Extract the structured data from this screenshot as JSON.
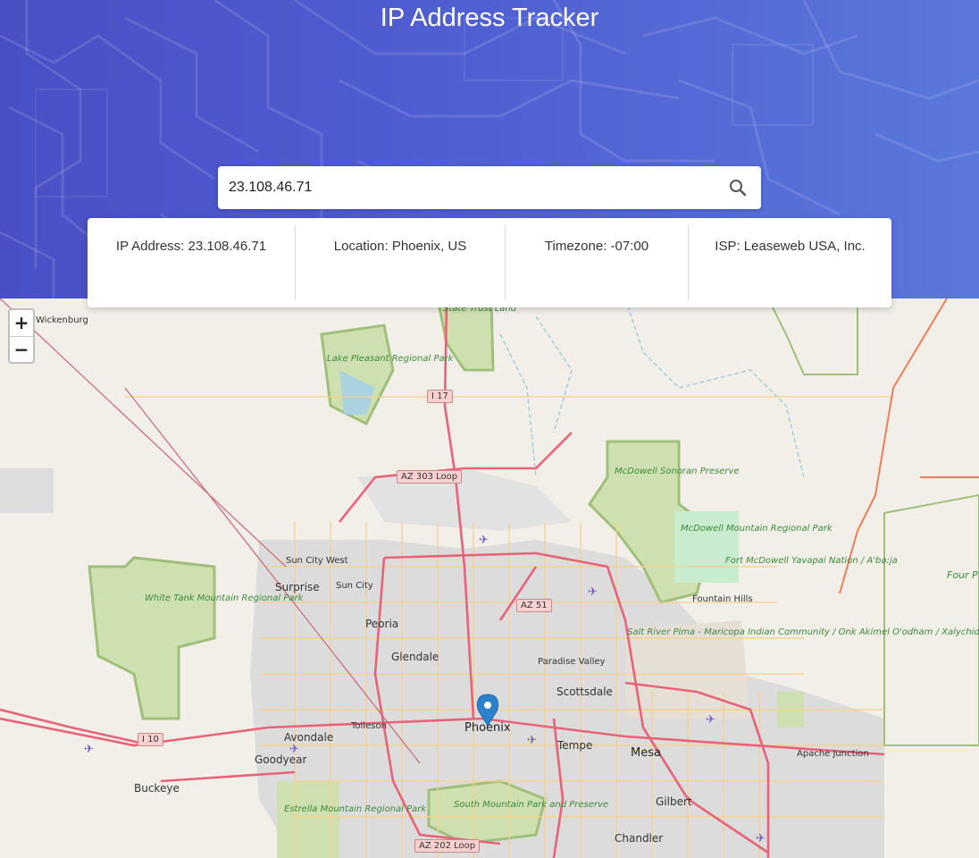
{
  "header": {
    "title": "IP Address Tracker"
  },
  "search": {
    "value": "23.108.46.71",
    "icon": "search-icon"
  },
  "info": {
    "ip": "IP Address: 23.108.46.71",
    "location": "Location: Phoenix, US",
    "timezone": "Timezone: -07:00",
    "isp": "ISP: Leaseweb USA, Inc."
  },
  "zoom": {
    "in": "+",
    "out": "−"
  },
  "map": {
    "places": {
      "wickenburg": "Wickenburg",
      "sun_city_west": "Sun City West",
      "surprise": "Surprise",
      "sun_city": "Sun City",
      "peoria": "Peoria",
      "glendale": "Glendale",
      "paradise_valley": "Paradise Valley",
      "scottsdale": "Scottsdale",
      "fountain_hills": "Fountain Hills",
      "tolleson": "Tolleson",
      "avondale": "Avondale",
      "goodyear": "Goodyear",
      "buckeye": "Buckeye",
      "phoenix": "Phoenix",
      "tempe": "Tempe",
      "mesa": "Mesa",
      "apache_junction": "Apache Junction",
      "gilbert": "Gilbert",
      "chandler": "Chandler"
    },
    "parks": {
      "state_trust": "State Trust Land",
      "lake_pleasant": "Lake Pleasant Regional Park",
      "mcdowell_sonoran": "McDowell Sonoran Preserve",
      "mcdowell_mountain": "McDowell Mountain Regional Park",
      "fort_mcdowell": "Fort McDowell Yavapai Nation / A'ba:ja",
      "four_peaks": "Four P Wilder",
      "white_tank": "White Tank Mountain Regional Park",
      "salt_river": "Salt River Pima - Maricopa Indian Community / Onk Akimel O'odham / Xalychidom Piipaash",
      "south_mountain": "South Mountain Park and Preserve",
      "estrella": "Estrella Mountain Regional Park"
    },
    "shields": {
      "i17": "I 17",
      "az303": "AZ 303 Loop",
      "az51": "AZ 51",
      "i10": "I 10",
      "az202": "AZ 202 Loop"
    }
  }
}
